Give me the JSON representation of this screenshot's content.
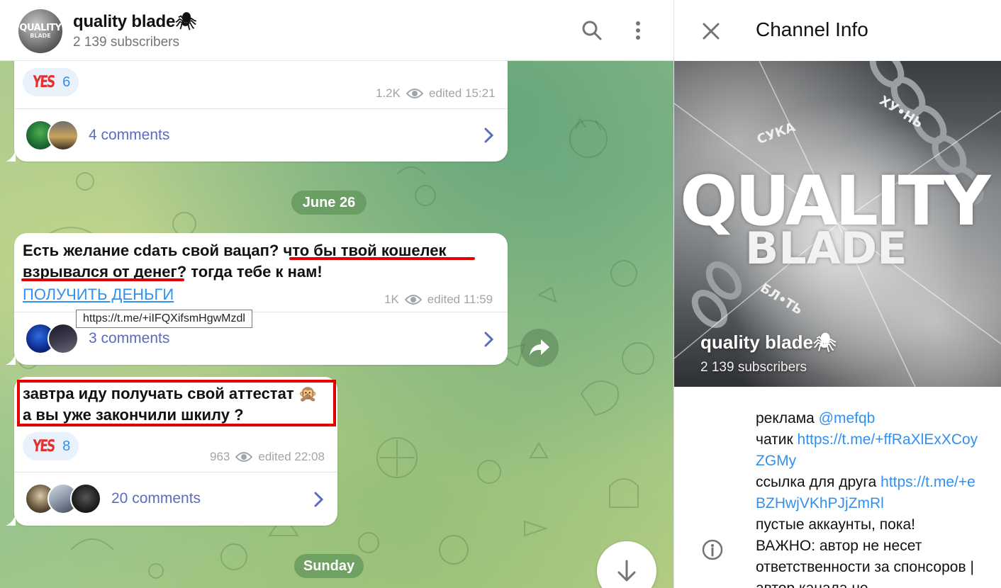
{
  "chat": {
    "title": "quality blade",
    "title_emoji": "🕷",
    "subscribers": "2 139 subscribers",
    "avatar_line1": "QUALITY",
    "avatar_line2": "BLADE"
  },
  "messages": [
    {
      "reaction_label": "YES",
      "reaction_count": "6",
      "views": "1.2K",
      "edited": "edited 15:21",
      "comments": "4 comments"
    },
    {
      "date": "June 26",
      "text_part1": "Есть желание cdать свой вацап? ",
      "text_part2": "что бы твой кошелек",
      "text_line2_a": "взрывался от денег",
      "text_line2_b": "? тогда тебе к нам!",
      "link_text": "ПОЛУЧИТЬ ДЕНЬГИ",
      "tooltip": "https://t.me/+iIFQXifsmHgwMzdl",
      "views": "1K",
      "edited": "edited 11:59",
      "comments": "3 comments"
    },
    {
      "text_line1": "завтра иду получать свой аттестат 🙊",
      "text_line2": "а вы уже закончили шкилу ?",
      "reaction_label": "YES",
      "reaction_count": "8",
      "views": "963",
      "edited": "edited 22:08",
      "comments": "20 comments"
    }
  ],
  "next_date": "Sunday",
  "info": {
    "title": "Channel Info",
    "cover_word1": "QUALITY",
    "cover_word2": "BLADE",
    "cover_tag1": "СУКА",
    "cover_tag2": "ХУ•НЬ",
    "cover_tag3": "БЛ•ТЬ",
    "name": "quality blade",
    "name_emoji": "🕷",
    "subscribers": "2 139 subscribers",
    "about": {
      "ad_label": "реклама ",
      "ad_handle": "@mefqb",
      "chat_label": "чатик ",
      "chat_link": "https://t.me/+ffRaXlExXCoyZGMy",
      "friend_label": "ссылка для друга ",
      "friend_link": "https://t.me/+eBZHwjVKhPJjZmRl",
      "line4": "пустые аккаунты, пока!",
      "line5": "ВАЖНО: автор не несет ответственности за спонсоров | автор канала не"
    }
  },
  "colors": {
    "accent": "#3390ec",
    "comments": "#5c6bc0",
    "highlight_red": "#e00000",
    "date_pill": "#60965a"
  }
}
